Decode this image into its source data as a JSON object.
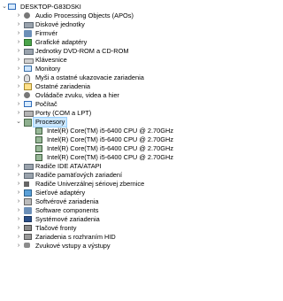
{
  "root": {
    "label": "DESKTOP-G83DSKI",
    "expanded": true
  },
  "categories": [
    {
      "label": "Audio Processing Objects (APOs)",
      "icon": "audio-icon",
      "expanded": false
    },
    {
      "label": "Diskové jednotky",
      "icon": "drive-icon",
      "expanded": false
    },
    {
      "label": "Firmvér",
      "icon": "firmware-icon",
      "expanded": false
    },
    {
      "label": "Grafické adaptéry",
      "icon": "display-adapter-icon",
      "expanded": false
    },
    {
      "label": "Jednotky DVD-ROM a CD-ROM",
      "icon": "dvd-drive-icon",
      "expanded": false
    },
    {
      "label": "Klávesnice",
      "icon": "keyboard-icon",
      "expanded": false
    },
    {
      "label": "Monitory",
      "icon": "monitor-icon",
      "expanded": false
    },
    {
      "label": "Myši a ostatné ukazovacie zariadenia",
      "icon": "mouse-icon",
      "expanded": false
    },
    {
      "label": "Ostatné zariadenia",
      "icon": "other-devices-icon",
      "expanded": false
    },
    {
      "label": "Ovládače zvuku, videa a hier",
      "icon": "sound-controller-icon",
      "expanded": false
    },
    {
      "label": "Počítač",
      "icon": "computer-icon",
      "expanded": false
    },
    {
      "label": "Porty (COM a LPT)",
      "icon": "port-icon",
      "expanded": false
    },
    {
      "label": "Procesory",
      "icon": "processor-icon",
      "expanded": true,
      "selected": true,
      "children": [
        "Intel(R) Core(TM) i5-6400 CPU @ 2.70GHz",
        "Intel(R) Core(TM) i5-6400 CPU @ 2.70GHz",
        "Intel(R) Core(TM) i5-6400 CPU @ 2.70GHz",
        "Intel(R) Core(TM) i5-6400 CPU @ 2.70GHz"
      ]
    },
    {
      "label": "Radiče IDE ATA/ATAPI",
      "icon": "ide-controller-icon",
      "expanded": false
    },
    {
      "label": "Radiče pamäťových zariadení",
      "icon": "storage-controller-icon",
      "expanded": false
    },
    {
      "label": "Radiče Univerzálnej sériovej zbernice",
      "icon": "usb-controller-icon",
      "expanded": false
    },
    {
      "label": "Sieťové adaptéry",
      "icon": "network-adapter-icon",
      "expanded": false
    },
    {
      "label": "Softvérové zariadenia",
      "icon": "software-device-icon",
      "expanded": false
    },
    {
      "label": "Software components",
      "icon": "software-component-icon",
      "expanded": false
    },
    {
      "label": "Systémové zariadenia",
      "icon": "system-device-icon",
      "expanded": false
    },
    {
      "label": "Tlačové fronty",
      "icon": "print-queue-icon",
      "expanded": false
    },
    {
      "label": "Zariadenia s rozhraním HID",
      "icon": "hid-icon",
      "expanded": false
    },
    {
      "label": "Zvukové vstupy a výstupy",
      "icon": "audio-io-icon",
      "expanded": false
    }
  ],
  "glyphs": {
    "collapsed": "›",
    "expanded": "⌄"
  }
}
